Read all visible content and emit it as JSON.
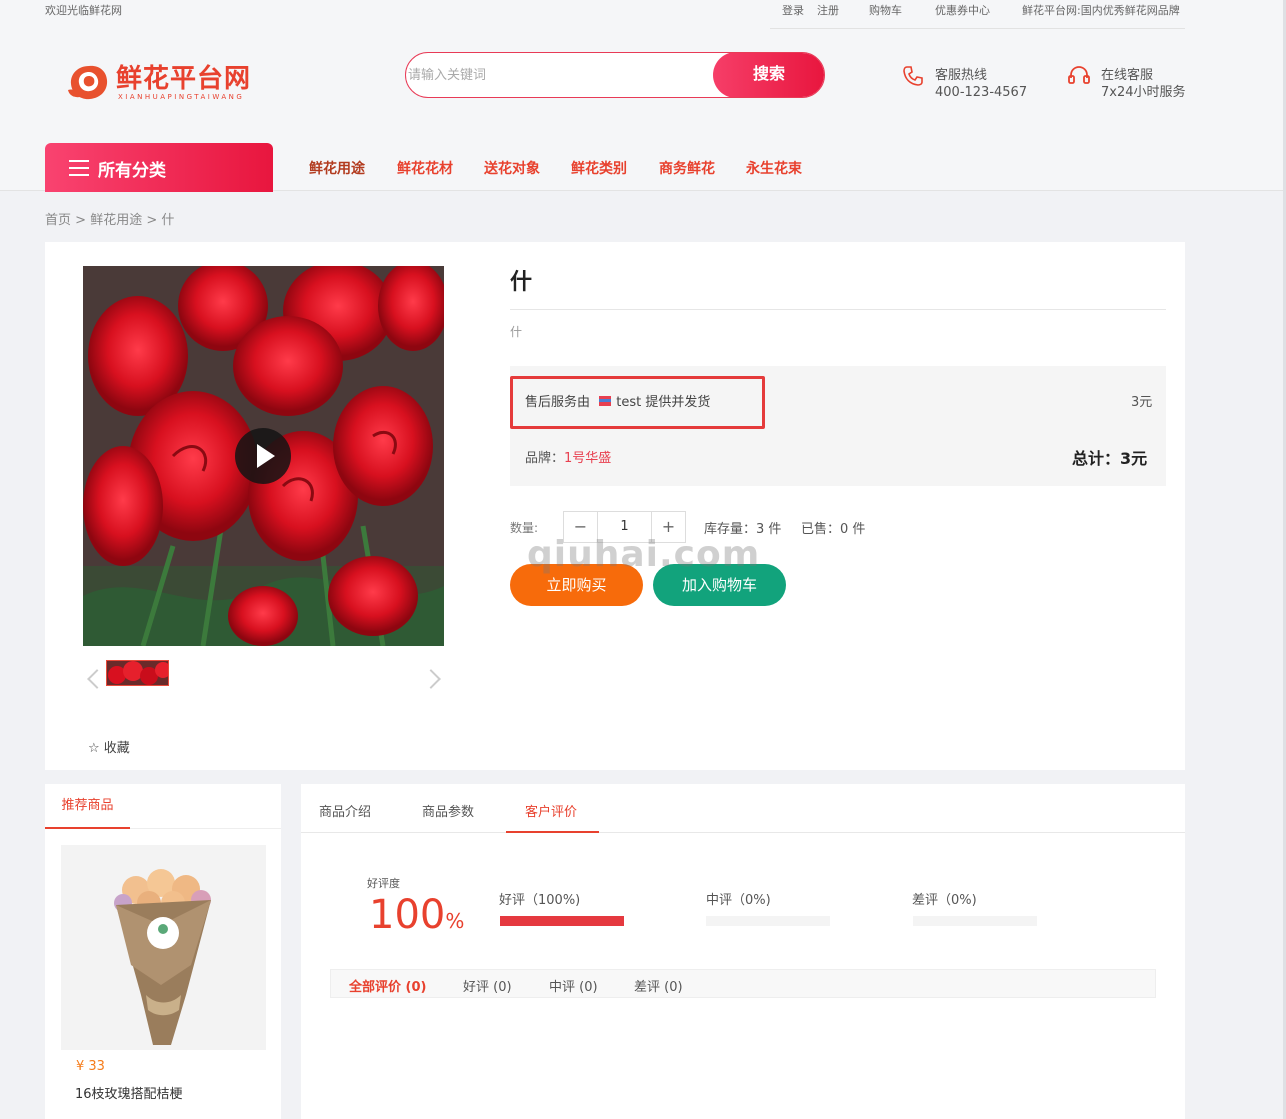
{
  "topbar": {
    "welcome": "欢迎光临鲜花网",
    "login": "登录",
    "register": "注册",
    "cart": "购物车",
    "coupon": "优惠券中心",
    "slogan": "鲜花平台网:国内优秀鲜花网品牌"
  },
  "header": {
    "logo_text": "鲜花平台网",
    "logo_sub": "XIANHUAPINGTAIWANG",
    "search_placeholder": "请输入关键词",
    "search_button": "搜索",
    "hotline_label": "客服热线",
    "hotline_number": "400-123-4567",
    "online_label": "在线客服",
    "online_hours": "7x24小时服务"
  },
  "nav": {
    "categories_button": "所有分类",
    "items": [
      "鲜花用途",
      "鲜花花材",
      "送花对象",
      "鲜花类别",
      "商务鲜花",
      "永生花束"
    ]
  },
  "breadcrumb": {
    "home": "首页",
    "sep1": ">",
    "category": "鲜花用途",
    "sep2": ">",
    "current": "什"
  },
  "product": {
    "title": "什",
    "subtitle": "什",
    "service_prefix": "售后服务由",
    "seller": "test",
    "service_suffix": "提供并发货",
    "unit_price": "3元",
    "brand_label": "品牌：",
    "brand_value": "1号华盛",
    "total": "总计：3元",
    "qty_label": "数量:",
    "qty_value": "1",
    "qty_minus": "−",
    "qty_plus": "+",
    "stock": "库存量：3 件",
    "sold": "已售：0 件",
    "buy_now": "立即购买",
    "add_cart": "加入购物车",
    "favorite": "收藏",
    "favorite_icon": "☆",
    "watermark": "qiuhai.com"
  },
  "sidebar": {
    "tab": "推荐商品",
    "item_price": "¥ 33",
    "item_name": "16枝玫瑰搭配桔梗"
  },
  "detail": {
    "tabs": [
      "商品介绍",
      "商品参数",
      "客户评价"
    ],
    "active_tab": "客户评价",
    "rating_label": "好评度",
    "rating_value": "100",
    "rating_unit": "%",
    "good": {
      "label": "好评（100%)",
      "ratio": 1.0
    },
    "mid": {
      "label": "中评（0%)",
      "ratio": 0
    },
    "bad": {
      "label": "差评（0%)",
      "ratio": 0
    },
    "filters": [
      "全部评价 (0)",
      "好评 (0)",
      "中评 (0)",
      "差评 (0)"
    ]
  },
  "colors": {
    "accent": "#e8412e",
    "search_gradient": "#e8163e",
    "buy": "#f76b0b",
    "cart": "#12a37c"
  }
}
